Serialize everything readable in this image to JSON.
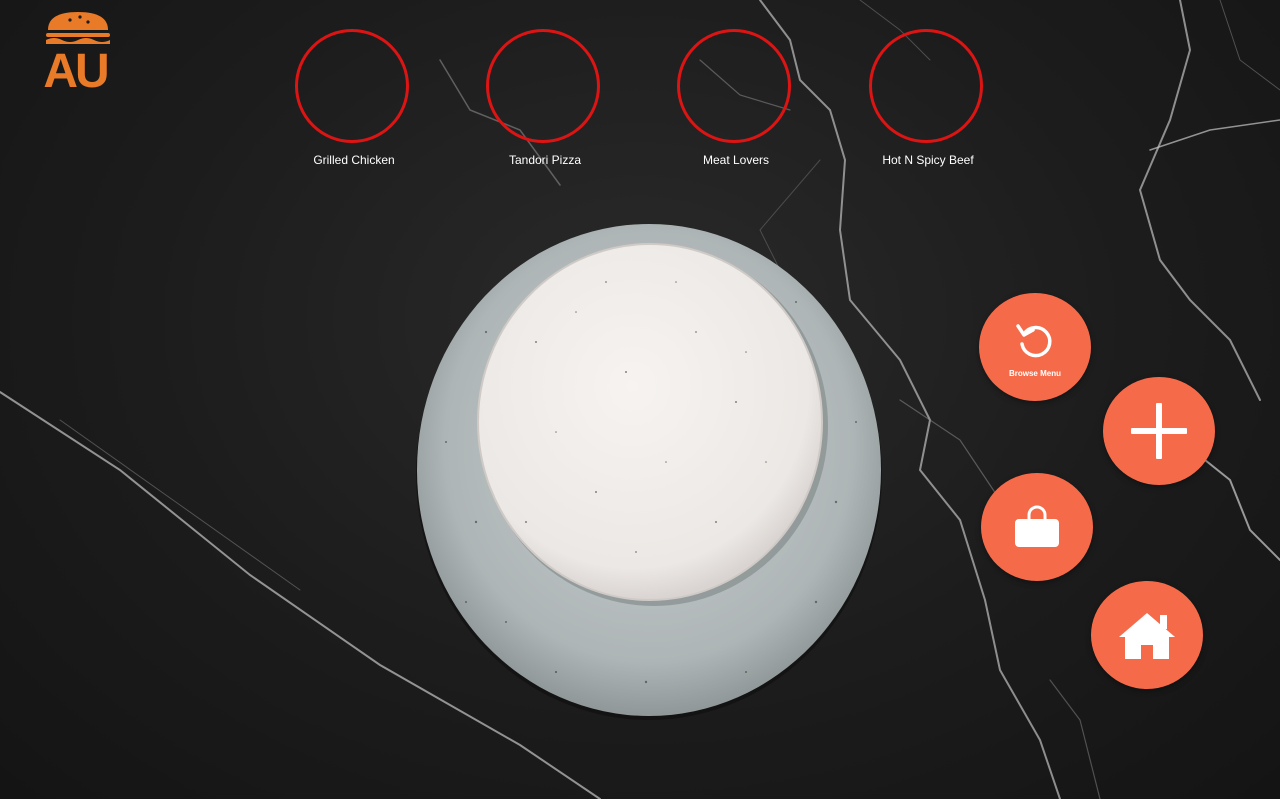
{
  "app": {
    "logo_text": "AU",
    "brand_color": "#e87a28",
    "ring_color": "#dc1414",
    "button_color": "#f56b4a"
  },
  "dishes": [
    {
      "label": "Grilled Chicken"
    },
    {
      "label": "Tandori Pizza"
    },
    {
      "label": "Meat Lovers"
    },
    {
      "label": "Hot N Spicy Beef"
    }
  ],
  "actions": {
    "browse_menu_label": "Browse Menu",
    "browse_menu_icon": "refresh-icon",
    "add_icon": "plus-icon",
    "bag_icon": "shopping-bag-icon",
    "home_icon": "home-icon"
  }
}
